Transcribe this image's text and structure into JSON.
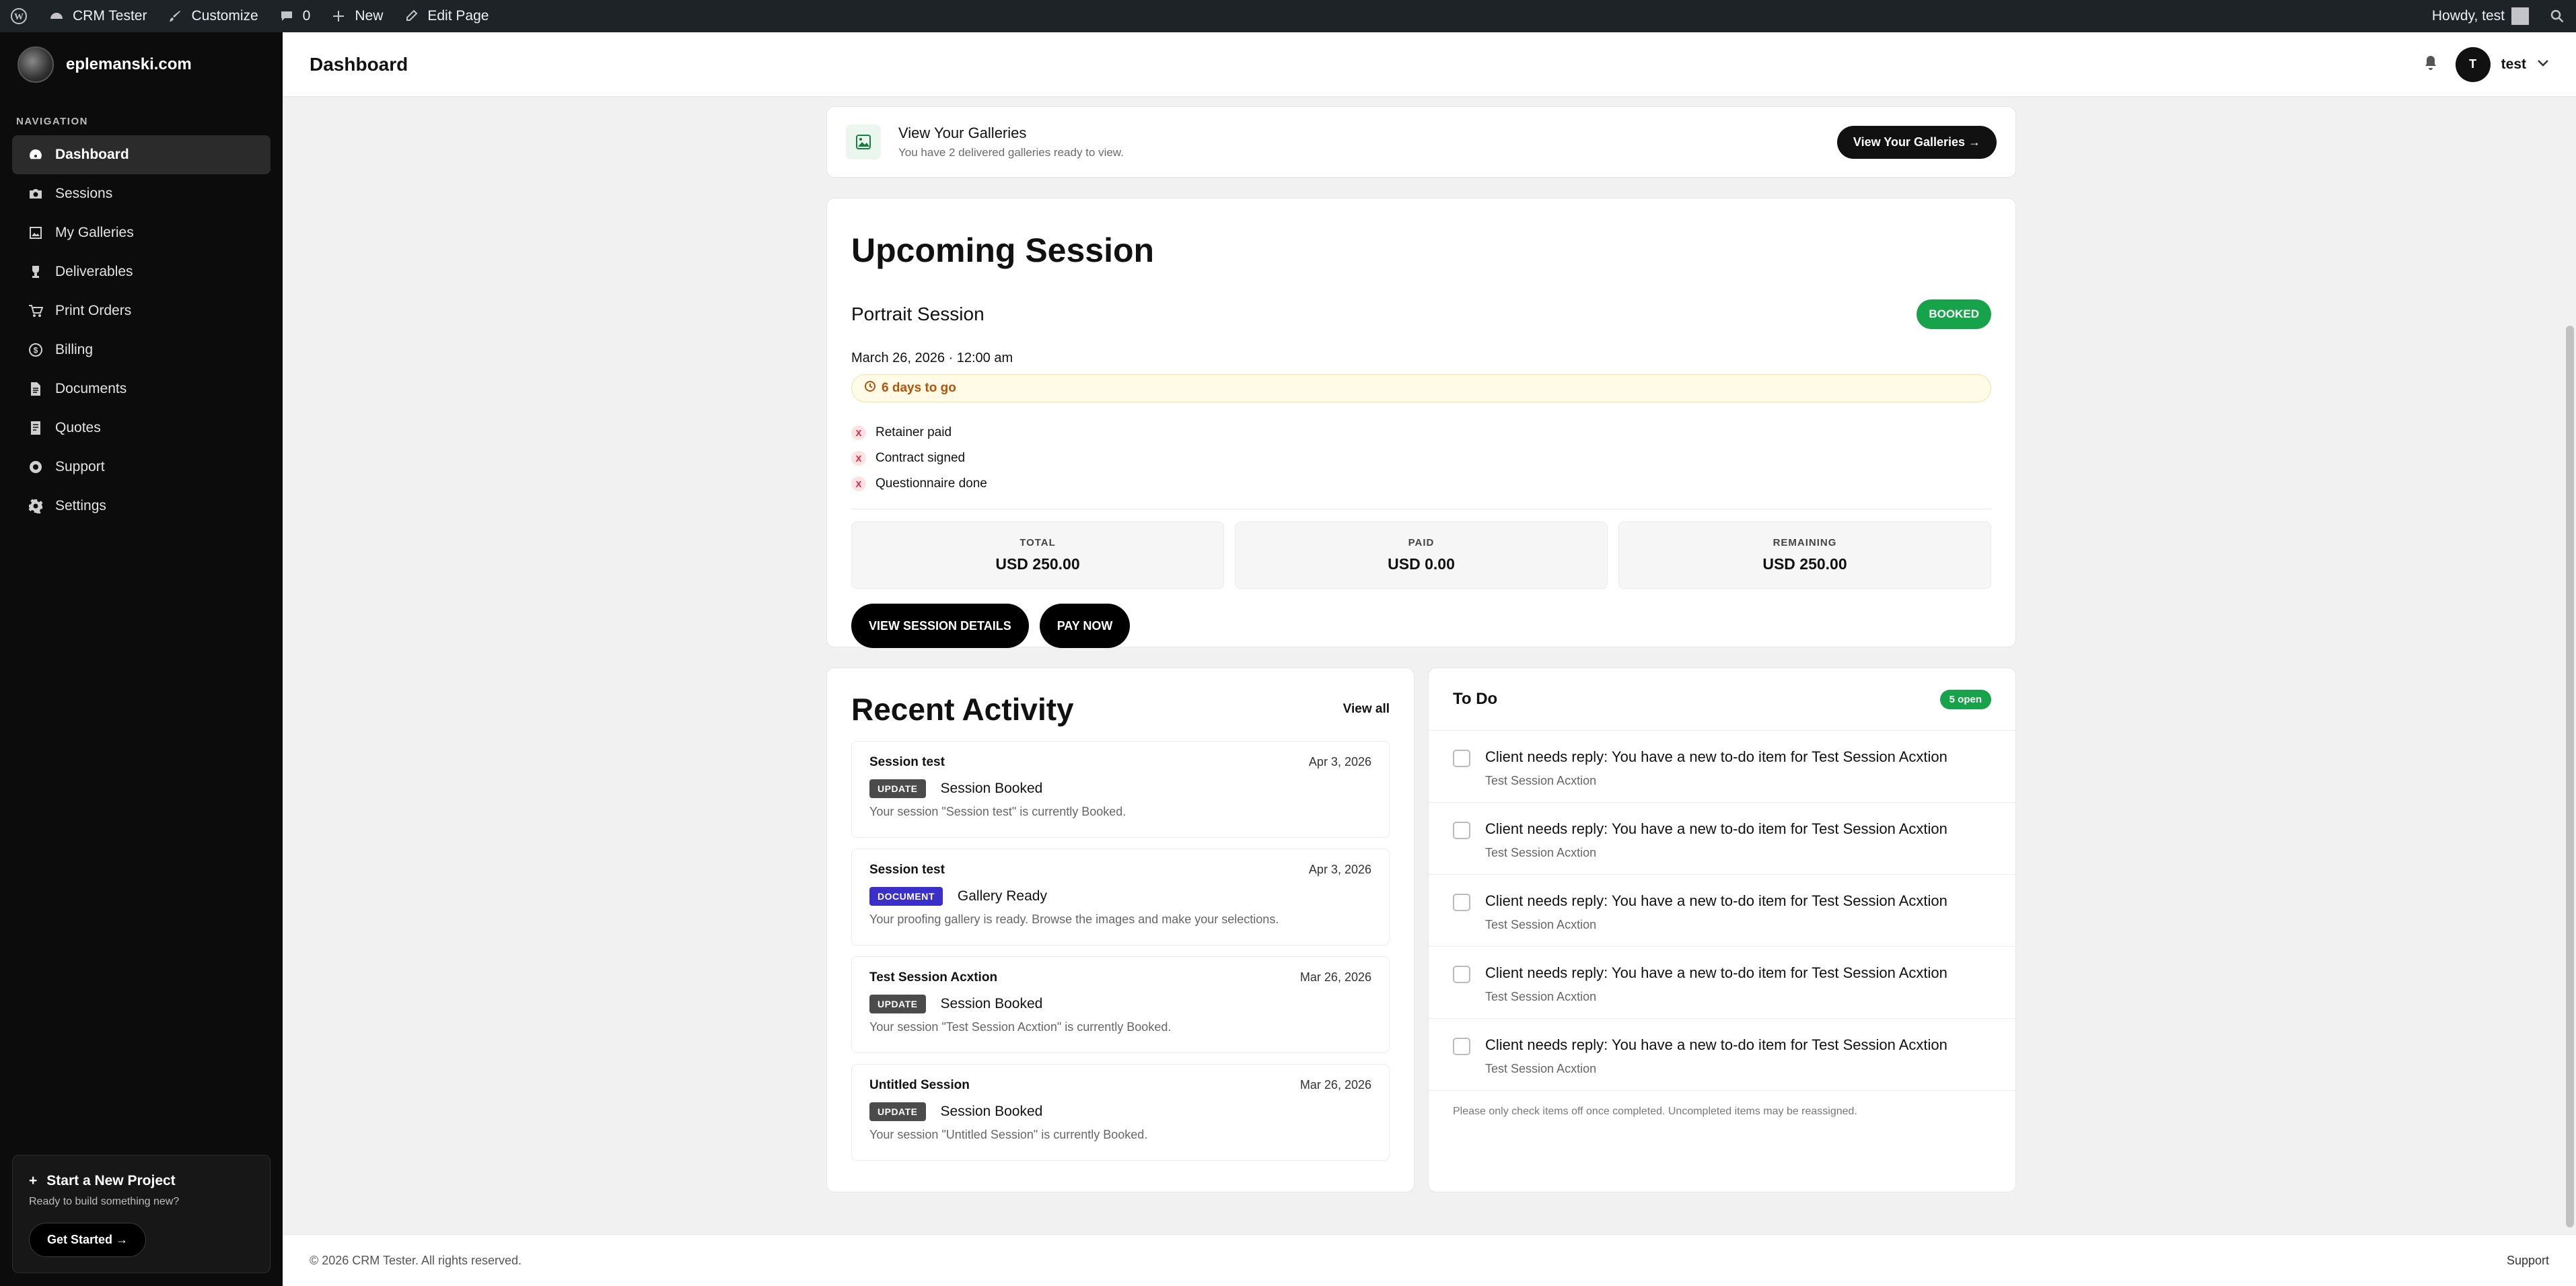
{
  "adminbar": {
    "site_name": "CRM Tester",
    "customize": "Customize",
    "comments": "0",
    "new": "New",
    "edit_page": "Edit Page",
    "howdy": "Howdy, test"
  },
  "sidebar": {
    "brand": "eplemanski.com",
    "nav_title": "NAVIGATION",
    "items": [
      {
        "label": "Dashboard",
        "icon": "dashboard-icon"
      },
      {
        "label": "Sessions",
        "icon": "camera-icon"
      },
      {
        "label": "My Galleries",
        "icon": "gallery-icon"
      },
      {
        "label": "Deliverables",
        "icon": "trophy-icon"
      },
      {
        "label": "Print Orders",
        "icon": "cart-icon"
      },
      {
        "label": "Billing",
        "icon": "dollar-icon"
      },
      {
        "label": "Documents",
        "icon": "document-icon"
      },
      {
        "label": "Quotes",
        "icon": "quote-icon"
      },
      {
        "label": "Support",
        "icon": "lifebuoy-icon"
      },
      {
        "label": "Settings",
        "icon": "gear-icon"
      }
    ],
    "promo": {
      "title": "Start a New Project",
      "subtitle": "Ready to build something new?",
      "button": "Get Started →"
    }
  },
  "header": {
    "title": "Dashboard",
    "avatar_letter": "T",
    "user": "test"
  },
  "galleries_banner": {
    "title": "View Your Galleries",
    "subtitle": "You have 2 delivered galleries ready to view.",
    "button": "View Your Galleries →"
  },
  "upcoming": {
    "heading": "Upcoming Session",
    "session_type": "Portrait Session",
    "status": "BOOKED",
    "datetime": "March 26, 2026 · 12:00 am",
    "countdown": "6 days to go",
    "checklist": [
      "Retainer paid",
      "Contract signed",
      "Questionnaire done"
    ],
    "totals": [
      {
        "label": "TOTAL",
        "value": "USD 250.00"
      },
      {
        "label": "PAID",
        "value": "USD 0.00"
      },
      {
        "label": "REMAINING",
        "value": "USD 250.00"
      }
    ],
    "view_details": "VIEW SESSION DETAILS",
    "pay_now": "PAY NOW"
  },
  "recent_activity": {
    "heading": "Recent Activity",
    "view_all": "View all",
    "items": [
      {
        "name": "Session test",
        "date": "Apr 3, 2026",
        "tag": "UPDATE",
        "tag_color": "#4b4b4b",
        "event": "Session Booked",
        "desc": "Your session \"Session test\" is currently Booked."
      },
      {
        "name": "Session test",
        "date": "Apr 3, 2026",
        "tag": "DOCUMENT",
        "tag_color": "#3b2fc9",
        "event": "Gallery Ready",
        "desc": "Your proofing gallery is ready. Browse the images and make your selections."
      },
      {
        "name": "Test Session Acxtion",
        "date": "Mar 26, 2026",
        "tag": "UPDATE",
        "tag_color": "#4b4b4b",
        "event": "Session Booked",
        "desc": "Your session \"Test Session Acxtion\" is currently Booked."
      },
      {
        "name": "Untitled Session",
        "date": "Mar 26, 2026",
        "tag": "UPDATE",
        "tag_color": "#4b4b4b",
        "event": "Session Booked",
        "desc": "Your session \"Untitled Session\" is currently Booked."
      }
    ]
  },
  "todo": {
    "heading": "To Do",
    "open_count": "5 open",
    "items": [
      {
        "text": "Client needs reply: You have a new to-do item for Test Session Acxtion",
        "sub": "Test Session Acxtion"
      },
      {
        "text": "Client needs reply: You have a new to-do item for Test Session Acxtion",
        "sub": "Test Session Acxtion"
      },
      {
        "text": "Client needs reply: You have a new to-do item for Test Session Acxtion",
        "sub": "Test Session Acxtion"
      },
      {
        "text": "Client needs reply: You have a new to-do item for Test Session Acxtion",
        "sub": "Test Session Acxtion"
      },
      {
        "text": "Client needs reply: You have a new to-do item for Test Session Acxtion",
        "sub": "Test Session Acxtion"
      }
    ],
    "note": "Please only check items off once completed. Uncompleted items may be reassigned."
  },
  "footer": {
    "copyright": "© 2026 CRM Tester. All rights reserved.",
    "support": "Support"
  },
  "colors": {
    "accent_green": "#16a34a",
    "sidebar_bg": "#0c0c0c",
    "countdown_text": "#b45309"
  }
}
